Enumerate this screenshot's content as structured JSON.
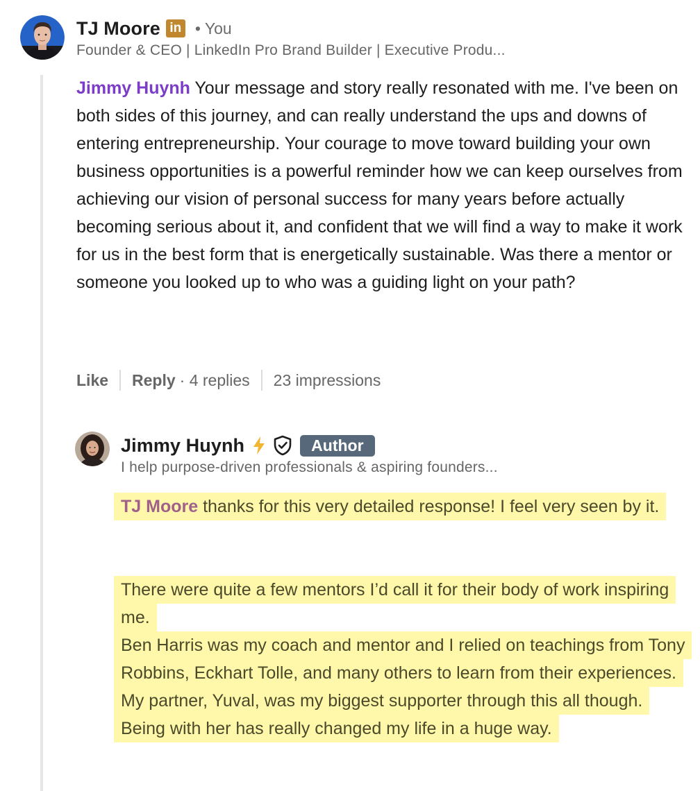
{
  "comment": {
    "author_name": "TJ Moore",
    "linkedin_badge": "in",
    "you_label": "• You",
    "headline": "Founder & CEO | LinkedIn Pro Brand Builder | Executive Produ...",
    "mention": "Jimmy Huynh",
    "text": " Your message and story really resonated with me. I've been on both sides of this journey, and can really understand the ups and downs of entering entrepreneurship. Your courage to move toward building your own business opportunities is a powerful reminder how we can keep ourselves from achieving our vision of personal success for many years before actually becoming serious about it, and confident that we will find a way to make it work for us in the best form that is energetically sustainable. Was there a mentor or someone you looked up to who was a guiding light on your path?",
    "actions": {
      "like_label": "Like",
      "reply_label": "Reply",
      "replies_count": "· 4 replies",
      "impressions": "23 impressions"
    }
  },
  "reply": {
    "author_name": "Jimmy Huynh",
    "author_tag": "Author",
    "headline": "I help purpose-driven professionals & aspiring founders...",
    "mention": "TJ Moore",
    "paragraph1": " thanks for this very detailed response! I feel very seen by it.",
    "paragraph2": "There were quite a few mentors I’d call it for their body of work inspiring me.",
    "paragraph3": "Ben Harris was my coach and mentor and I relied on teachings from Tony Robbins, Eckhart Tolle, and many others to learn from their experiences. My partner, Yuval, was my biggest supporter through this all though. Being with her has really changed my life in a huge way."
  },
  "icons": {
    "linkedin_badge": "linkedin-premium-icon",
    "creator": "lightning-bolt-icon",
    "verified": "shield-check-icon"
  },
  "colors": {
    "mention": "#7b3dc8",
    "highlight": "#fff8ab",
    "author_tag_bg": "#56687a",
    "linkedin_badge": "#c1872f"
  }
}
